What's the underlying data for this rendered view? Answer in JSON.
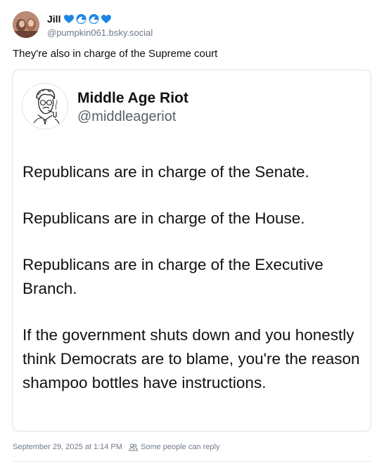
{
  "post": {
    "author": {
      "display_name": "Jill",
      "emojis": [
        "blue-heart",
        "wave",
        "wave",
        "blue-heart"
      ],
      "handle": "@pumpkin061.bsky.social"
    },
    "text": "They're also in charge of the Supreme court",
    "quoted": {
      "display_name": "Middle Age Riot",
      "handle": "@middleageriot",
      "paragraphs": [
        "Republicans are in charge of the Senate.",
        "Republicans are in charge of the House.",
        "Republicans are in charge of the Executive Branch.",
        "If the government shuts down and you honestly think Democrats are to blame, you're the reason shampoo bottles have instructions."
      ]
    },
    "timestamp": "September 29, 2025 at 1:14 PM",
    "reply_setting": "Some people can reply"
  },
  "colors": {
    "heart": "#1d86e8",
    "wave": "#1d86e8",
    "muted_text": "#6f7b89",
    "border": "#dde3ea"
  }
}
